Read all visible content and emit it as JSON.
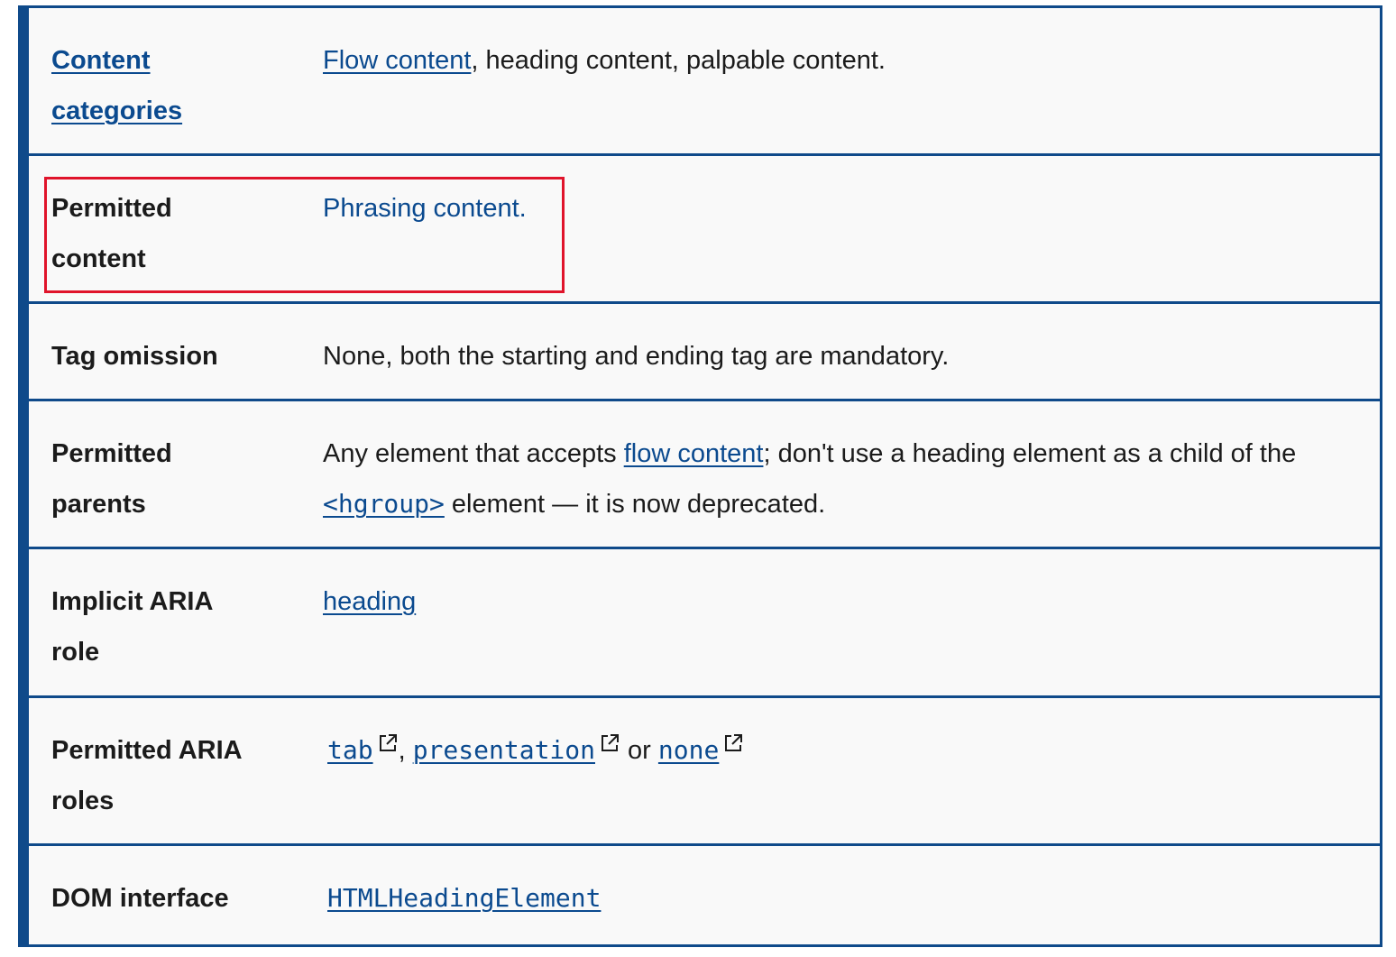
{
  "rows": [
    {
      "label_line1": "Content",
      "label_line2": "categories",
      "value_link": "Flow content",
      "value_rest": ", heading content, palpable content."
    },
    {
      "label_line1": "Permitted",
      "label_line2": "content",
      "value_link": "Phrasing content."
    },
    {
      "label": "Tag omission",
      "value": "None, both the starting and ending tag are mandatory."
    },
    {
      "label_line1": "Permitted",
      "label_line2": "parents",
      "value_part1": "Any element that accepts ",
      "value_link1": "flow content",
      "value_part2": "; don't use a heading element as a child of the ",
      "value_code_link": "<hgroup>",
      "value_part3": " element — it is now deprecated."
    },
    {
      "label_line1": "Implicit ARIA",
      "label_line2": "role",
      "value_link": "heading"
    },
    {
      "label_line1": "Permitted ARIA",
      "label_line2": "roles",
      "link1": "tab",
      "sep1": ", ",
      "link2": "presentation",
      "sep2": " or ",
      "link3": "none"
    },
    {
      "label": "DOM interface",
      "value_code_link": "HTMLHeadingElement"
    }
  ],
  "colors": {
    "border": "#0f4a8a",
    "link": "#0b4a8f",
    "text": "#1b1b1b",
    "row_bg": "#f9f9f9",
    "highlight": "#e0142b"
  },
  "icons": {
    "external_link": "external-link-icon"
  }
}
